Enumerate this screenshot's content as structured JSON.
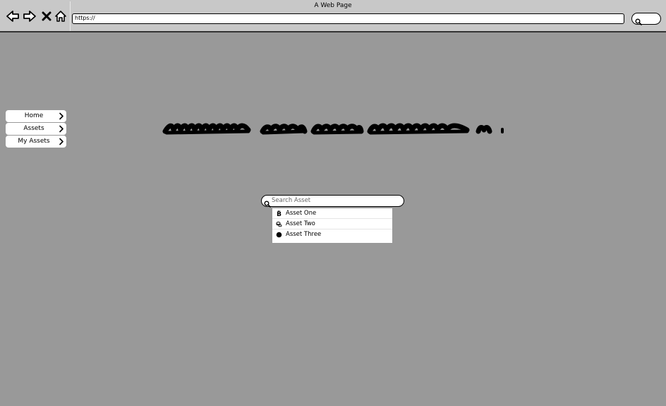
{
  "browser": {
    "window_title": "A Web Page",
    "url": "https://",
    "nav_icons": [
      "back-arrow-icon",
      "forward-arrow-icon",
      "stop-icon",
      "home-icon"
    ],
    "search_icon": "search-icon"
  },
  "sidebar": {
    "items": [
      {
        "label": "Home",
        "icon": "chevron-right-icon"
      },
      {
        "label": "Assets",
        "icon": "chevron-right-icon"
      },
      {
        "label": "My Assets",
        "icon": "chevron-right-icon"
      }
    ]
  },
  "asset_search": {
    "placeholder": "Search Asset",
    "value": "",
    "icon": "search-icon",
    "results": [
      {
        "label": "Asset One",
        "icon": "bitcoin-icon"
      },
      {
        "label": "Asset Two",
        "icon": "coin-stack-icon"
      },
      {
        "label": "Asset Three",
        "icon": "filled-circle-icon"
      }
    ]
  },
  "colors": {
    "page_background": "#999999",
    "chrome_background": "#c8c8c8",
    "surface": "#ffffff",
    "ink": "#000000"
  }
}
